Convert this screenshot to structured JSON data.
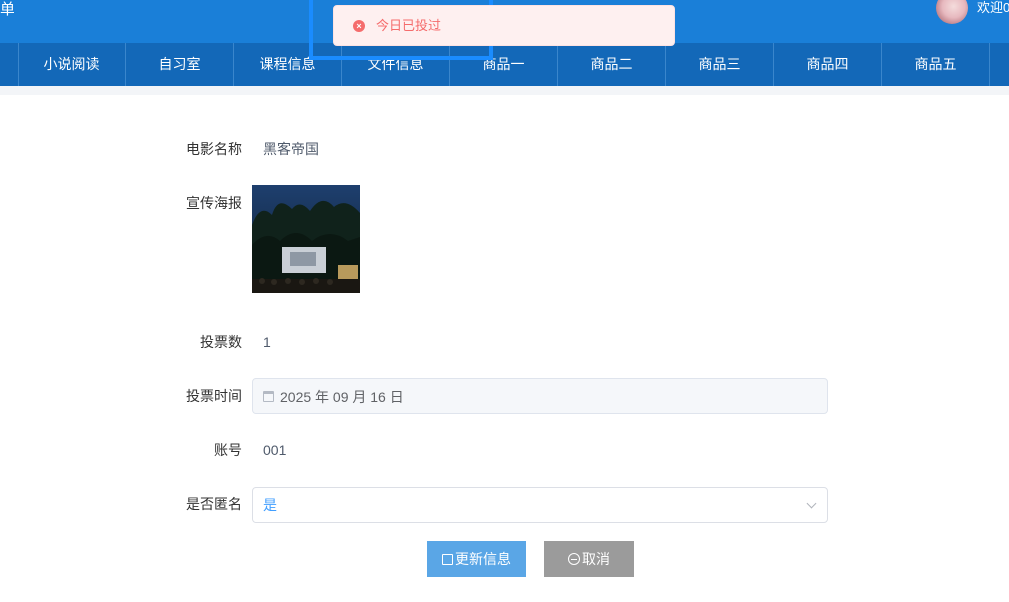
{
  "header": {
    "title": "单",
    "welcome": "欢迎0"
  },
  "nav": {
    "items": [
      "小说阅读",
      "自习室",
      "课程信息",
      "文件信息",
      "商品一",
      "商品二",
      "商品三",
      "商品四",
      "商品五"
    ]
  },
  "toast": {
    "message": "今日已投过",
    "type": "error",
    "color": "#f56c6c"
  },
  "form": {
    "movie_name": {
      "label": "电影名称",
      "value": "黑客帝国"
    },
    "poster": {
      "label": "宣传海报"
    },
    "votes": {
      "label": "投票数",
      "value": "1"
    },
    "vote_time": {
      "label": "投票时间",
      "value": "2025 年 09 月 16 日"
    },
    "account": {
      "label": "账号",
      "value": "001"
    },
    "anonymous": {
      "label": "是否匿名",
      "value": "是"
    }
  },
  "buttons": {
    "update": "更新信息",
    "cancel": "取消"
  },
  "colors": {
    "topbar": "#1a7fd8",
    "nav": "#1368b8",
    "update_button": "#5aa6e6",
    "cancel_button": "#9b9b9b",
    "accent": "#409eff"
  }
}
